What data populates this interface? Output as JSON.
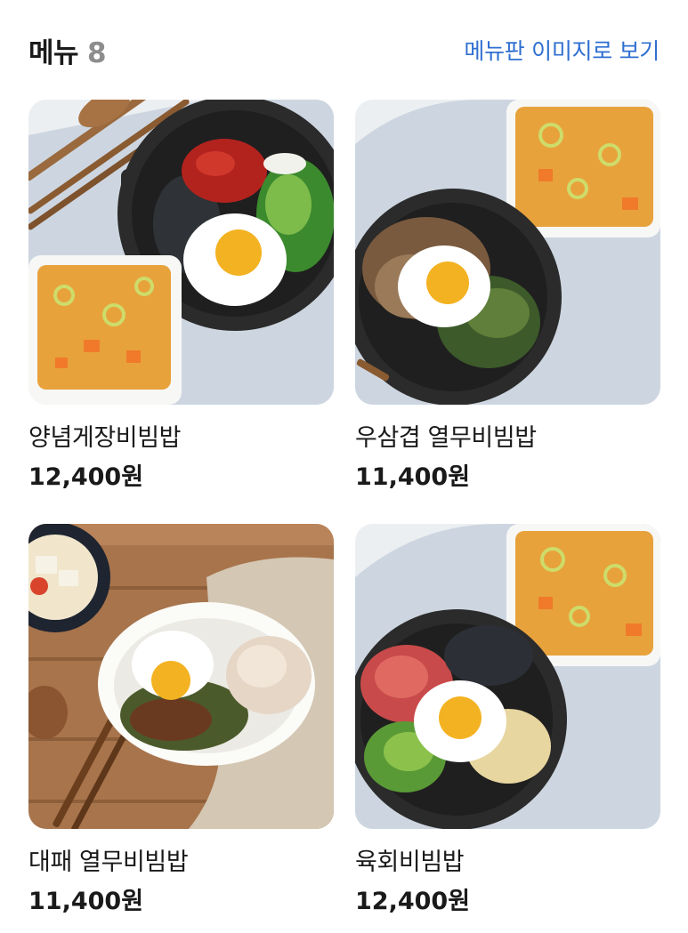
{
  "header": {
    "title": "메뉴",
    "count": "8",
    "view_menu_image_link": "메뉴판 이미지로 보기"
  },
  "menu_items": [
    {
      "name": "양념게장비빔밥",
      "price": "12,400원",
      "image_icon": "bibimbap-crab-photo"
    },
    {
      "name": "우삼겹 열무비빔밥",
      "price": "11,400원",
      "image_icon": "bibimbap-beef-brisket-photo"
    },
    {
      "name": "대패 열무비빔밥",
      "price": "11,400원",
      "image_icon": "bibimbap-pork-photo"
    },
    {
      "name": "육회비빔밥",
      "price": "12,400원",
      "image_icon": "bibimbap-beef-tartare-photo"
    }
  ],
  "colors": {
    "link": "#2f6fd0",
    "count": "#8d8d8d",
    "text": "#1a1a1a"
  }
}
